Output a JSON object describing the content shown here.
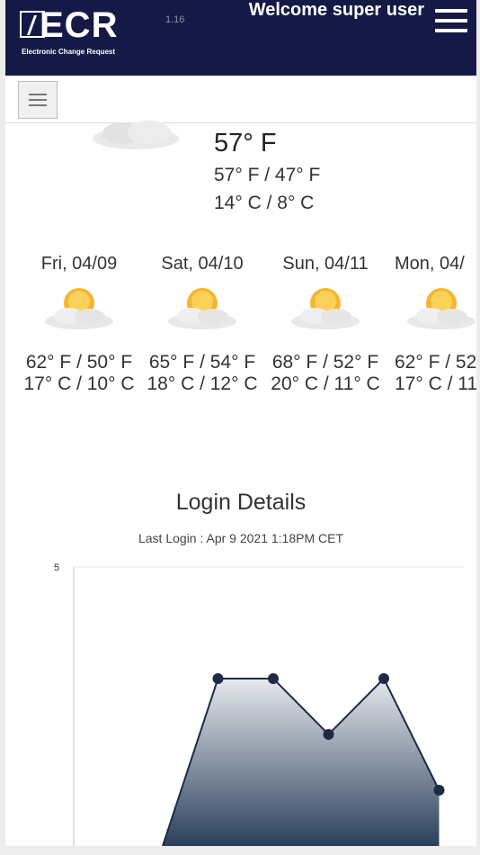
{
  "header": {
    "logo_text": "ECR",
    "logo_subtitle": "Electronic Change Request",
    "version": "1.16",
    "welcome": "Welcome super user"
  },
  "weather": {
    "current_temp": "57° F",
    "range_f": "57° F / 47° F",
    "range_c": "14° C / 8° C",
    "days": [
      {
        "date": "Fri, 04/09",
        "f": "62° F / 50° F",
        "c": "17° C / 10° C",
        "icon": "partly-cloudy-icon"
      },
      {
        "date": "Sat, 04/10",
        "f": "65° F / 54° F",
        "c": "18° C / 12° C",
        "icon": "partly-cloudy-icon"
      },
      {
        "date": "Sun, 04/11",
        "f": "68° F / 52° F",
        "c": "20° C / 11° C",
        "icon": "partly-cloudy-icon"
      },
      {
        "date": "Mon, 04/",
        "f": "62° F / 52",
        "c": "17° C / 11",
        "icon": "partly-cloudy-icon"
      }
    ]
  },
  "login": {
    "title": "Login Details",
    "last_login": "Last Login : Apr 9 2021 1:18PM CET"
  },
  "chart_data": {
    "type": "area",
    "ylim": [
      0,
      5
    ],
    "y_tick_labels": [
      "5"
    ],
    "x": [
      1,
      2,
      3,
      4,
      5,
      6,
      7
    ],
    "values": [
      0,
      0,
      3,
      3,
      2,
      3,
      1
    ],
    "markers": [
      false,
      false,
      true,
      true,
      true,
      true,
      true
    ],
    "colors": {
      "top": "#e6e9ee",
      "bottom": "#2b3f5b",
      "line": "#1e2b44"
    }
  }
}
